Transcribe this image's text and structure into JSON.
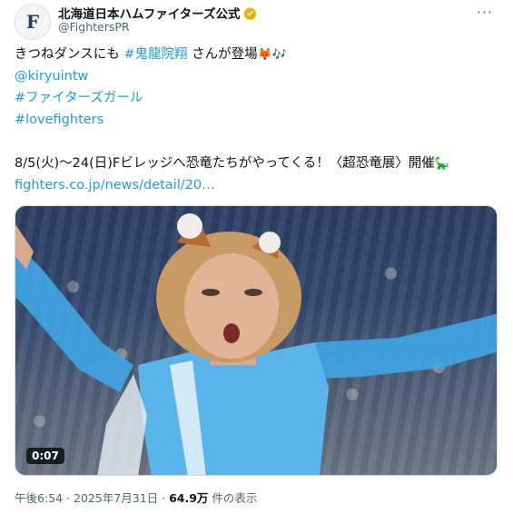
{
  "account": {
    "display_name": "北海道日本ハムファイターズ公式",
    "handle": "@FightersPR",
    "avatar_letter": "F"
  },
  "tweet": {
    "line1_prefix": "きつねダンスにも ",
    "line1_hashtag": "#鬼龍院翔",
    "line1_suffix": " さんが登場",
    "line1_emojis": "🦊🎶",
    "mention": "@kiryuintw",
    "hashtag2": "#ファイターズガール",
    "hashtag3": "#lovefighters",
    "event_line": "8/5(火)〜24(日)Fビレッジへ恐竜たちがやってくる！〈超恐竜展〉開催",
    "event_emoji": "🦕",
    "link": "fighters.co.jp/news/detail/20…"
  },
  "media": {
    "duration": "0:07"
  },
  "meta": {
    "time": "午後6:54",
    "separator": " · ",
    "date": "2025年7月31日",
    "views_count": "64.9万",
    "views_label": " 件の表示"
  },
  "colors": {
    "link": "#1d9bf0",
    "text": "#0f1419",
    "secondary": "#536471",
    "verified": "#e8b100"
  }
}
